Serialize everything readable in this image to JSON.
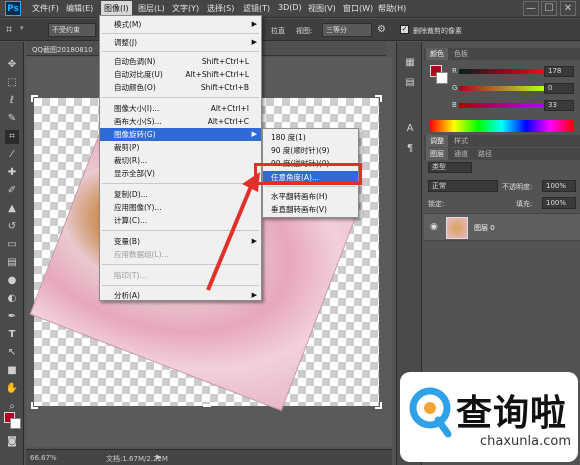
{
  "menubar": {
    "logo": "Ps",
    "items": [
      "文件(F)",
      "编辑(E)",
      "图像(I)",
      "图层(L)",
      "文字(Y)",
      "选择(S)",
      "滤镜(T)",
      "3D(D)",
      "视图(V)",
      "窗口(W)",
      "帮助(H)"
    ],
    "window_controls": [
      "—",
      "☐",
      "✕"
    ]
  },
  "options_bar": {
    "ratio_select": "不受约束",
    "straighten": "拉直",
    "view_label": "视图:",
    "view_select": "三等分",
    "delete_cropped_label": "删除裁剪的像素"
  },
  "document": {
    "tab_title": "QQ截图20180810",
    "zoom": "66.67%",
    "doc_info": "文档:1.67M/2.22M"
  },
  "image_menu": {
    "items": [
      {
        "label": "模式(M)",
        "submenu": true
      },
      {
        "label": "调整(J)",
        "submenu": true
      },
      {
        "label": "自动色调(N)",
        "shortcut": "Shift+Ctrl+L"
      },
      {
        "label": "自动对比度(U)",
        "shortcut": "Alt+Shift+Ctrl+L"
      },
      {
        "label": "自动颜色(O)",
        "shortcut": "Shift+Ctrl+B"
      },
      {
        "label": "图像大小(I)...",
        "shortcut": "Alt+Ctrl+I"
      },
      {
        "label": "画布大小(S)...",
        "shortcut": "Alt+Ctrl+C"
      },
      {
        "label": "图像旋转(G)",
        "submenu": true
      },
      {
        "label": "裁剪(P)"
      },
      {
        "label": "裁切(R)..."
      },
      {
        "label": "显示全部(V)"
      },
      {
        "label": "复制(D)..."
      },
      {
        "label": "应用图像(Y)..."
      },
      {
        "label": "计算(C)..."
      },
      {
        "label": "变量(B)",
        "submenu": true
      },
      {
        "label": "应用数据组(L)..."
      },
      {
        "label": "陷印(T)..."
      },
      {
        "label": "分析(A)",
        "submenu": true
      }
    ]
  },
  "rotate_submenu": {
    "items": [
      "180 度(1)",
      "90 度(顺时针)(9)",
      "90 度(逆时针)(0)",
      "任意角度(A)...",
      "水平翻转画布(H)",
      "垂直翻转画布(V)"
    ]
  },
  "color_panel": {
    "tabs": [
      "颜色",
      "色板"
    ],
    "channels": [
      {
        "label": "R",
        "value": "178"
      },
      {
        "label": "G",
        "value": "0"
      },
      {
        "label": "B",
        "value": "33"
      }
    ],
    "fg_color": "#b20021"
  },
  "adjust_panel": {
    "tabs": [
      "调整",
      "样式"
    ]
  },
  "layers_panel": {
    "tabs": [
      "图层",
      "通道",
      "路径"
    ],
    "kind_select": "类型",
    "blend_mode": "正常",
    "opacity_label": "不透明度:",
    "opacity_value": "100%",
    "lock_label": "锁定:",
    "fill_label": "填充:",
    "fill_value": "100%",
    "layer_name": "图层 0"
  },
  "watermark": {
    "text": "查询啦",
    "url": "chaxunla.com"
  }
}
